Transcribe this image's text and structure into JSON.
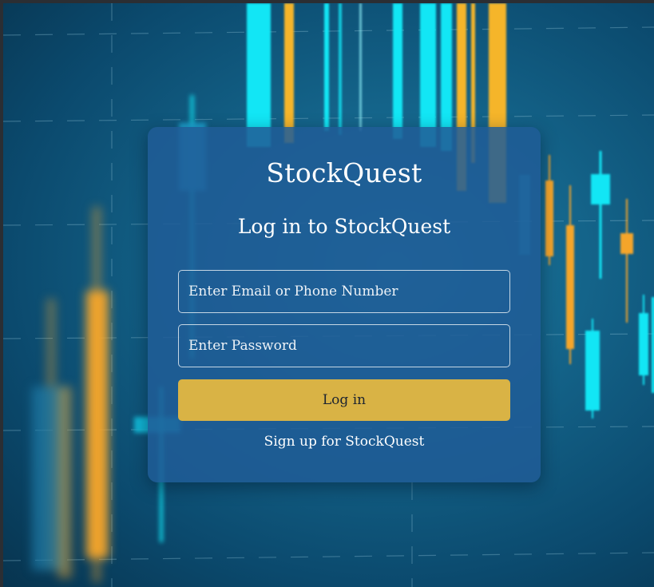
{
  "background": {
    "description_colors": {
      "up_candle": "#12e6f5",
      "down_candle": "#f5a52a",
      "grid_line": "#8fc3d8"
    }
  },
  "login_card": {
    "brand_title": "StockQuest",
    "heading": "Log in to StockQuest",
    "email_placeholder": "Enter Email or Phone Number",
    "email_value": "",
    "password_placeholder": "Enter Password",
    "password_value": "",
    "login_label": "Log in",
    "signup_label": "Sign up for StockQuest"
  },
  "colors": {
    "card_background": "#205c96",
    "login_button": "#d9b345",
    "text": "#ffffff"
  }
}
